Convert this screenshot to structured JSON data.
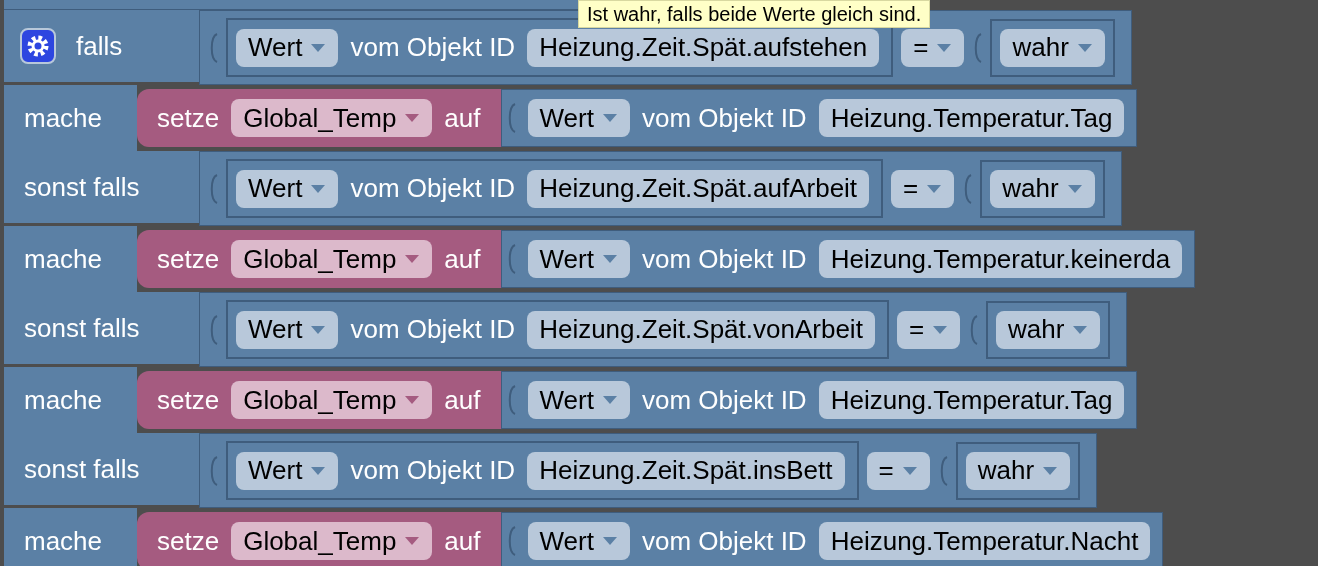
{
  "tooltip": "Ist wahr, falls beide Werte gleich sind.",
  "clauses": [
    {
      "kind": "if",
      "label": "falls",
      "condition": {
        "property": "Wert",
        "connector": "vom Objekt ID",
        "object_id": "Heizung.Zeit.Spät.aufstehen",
        "operator": "=",
        "value": "wahr"
      }
    },
    {
      "kind": "do",
      "label": "mache",
      "statement": {
        "verb": "setze",
        "variable": "Global_Temp",
        "connector": "auf",
        "property": "Wert",
        "of": "vom Objekt ID",
        "object_id": "Heizung.Temperatur.Tag"
      }
    },
    {
      "kind": "if",
      "label": "sonst falls",
      "condition": {
        "property": "Wert",
        "connector": "vom Objekt ID",
        "object_id": "Heizung.Zeit.Spät.aufArbeit",
        "operator": "=",
        "value": "wahr"
      }
    },
    {
      "kind": "do",
      "label": "mache",
      "statement": {
        "verb": "setze",
        "variable": "Global_Temp",
        "connector": "auf",
        "property": "Wert",
        "of": "vom Objekt ID",
        "object_id": "Heizung.Temperatur.keinerda"
      }
    },
    {
      "kind": "if",
      "label": "sonst falls",
      "condition": {
        "property": "Wert",
        "connector": "vom Objekt ID",
        "object_id": "Heizung.Zeit.Spät.vonArbeit",
        "operator": "=",
        "value": "wahr"
      }
    },
    {
      "kind": "do",
      "label": "mache",
      "statement": {
        "verb": "setze",
        "variable": "Global_Temp",
        "connector": "auf",
        "property": "Wert",
        "of": "vom Objekt ID",
        "object_id": "Heizung.Temperatur.Tag"
      }
    },
    {
      "kind": "if",
      "label": "sonst falls",
      "condition": {
        "property": "Wert",
        "connector": "vom Objekt ID",
        "object_id": "Heizung.Zeit.Spät.insBett",
        "operator": "=",
        "value": "wahr"
      }
    },
    {
      "kind": "do",
      "label": "mache",
      "statement": {
        "verb": "setze",
        "variable": "Global_Temp",
        "connector": "auf",
        "property": "Wert",
        "of": "vom Objekt ID",
        "object_id": "Heizung.Temperatur.Nacht"
      }
    }
  ]
}
